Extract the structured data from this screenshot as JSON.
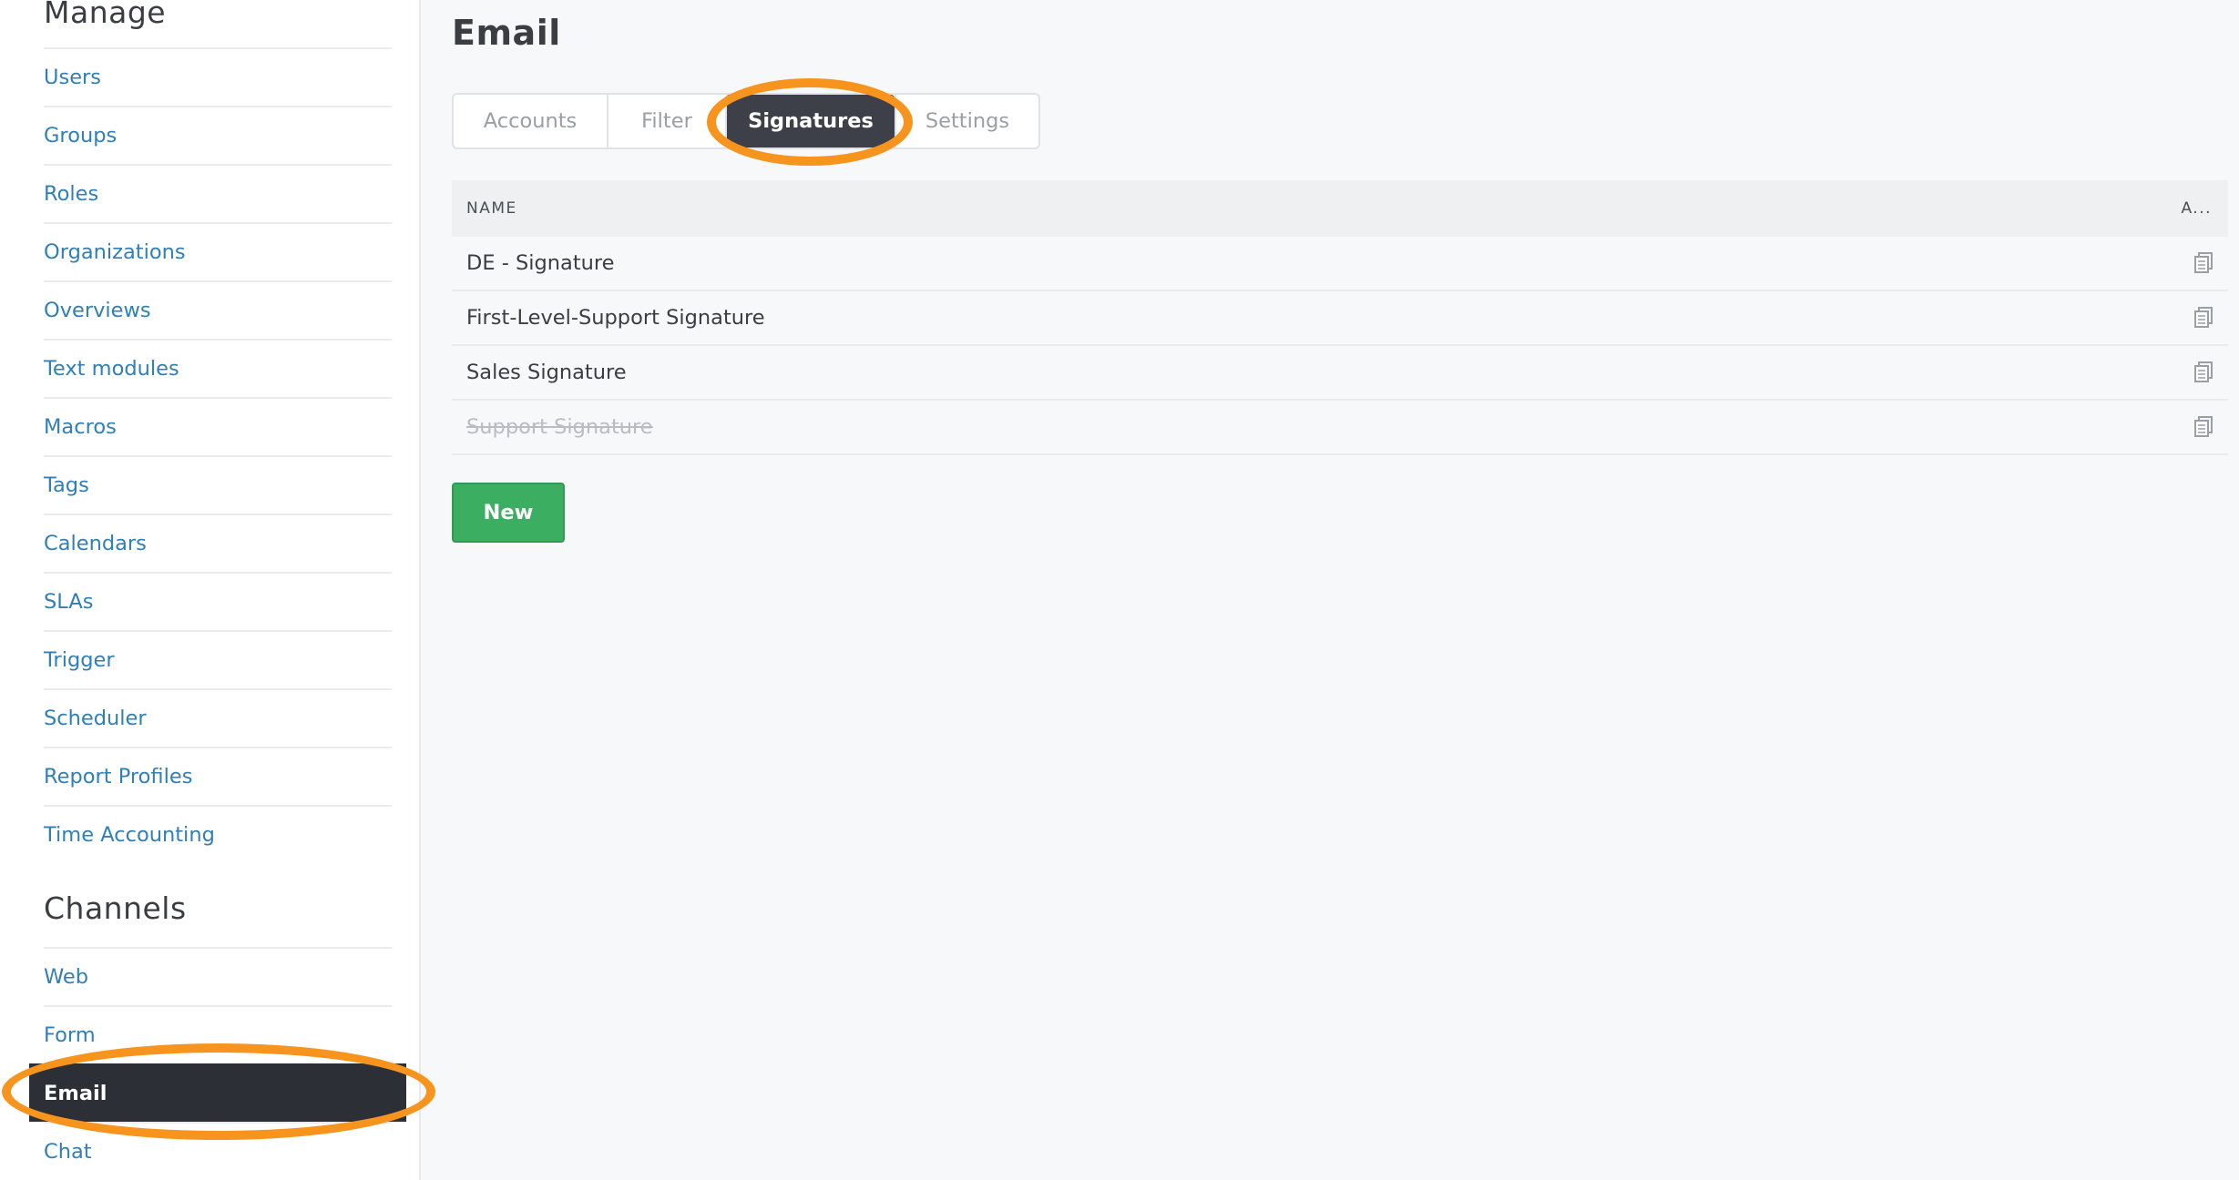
{
  "sidebar": {
    "manage_heading": "Manage",
    "manage_items": [
      {
        "label": "Users"
      },
      {
        "label": "Groups"
      },
      {
        "label": "Roles"
      },
      {
        "label": "Organizations"
      },
      {
        "label": "Overviews"
      },
      {
        "label": "Text modules"
      },
      {
        "label": "Macros"
      },
      {
        "label": "Tags"
      },
      {
        "label": "Calendars"
      },
      {
        "label": "SLAs"
      },
      {
        "label": "Trigger"
      },
      {
        "label": "Scheduler"
      },
      {
        "label": "Report Profiles"
      },
      {
        "label": "Time Accounting"
      }
    ],
    "channels_heading": "Channels",
    "channel_items": [
      {
        "label": "Web"
      },
      {
        "label": "Form"
      },
      {
        "label": "Email",
        "active": true
      },
      {
        "label": "Chat"
      }
    ]
  },
  "main": {
    "title": "Email",
    "tabs": [
      {
        "label": "Accounts"
      },
      {
        "label": "Filter"
      },
      {
        "label": "Signatures",
        "active": true
      },
      {
        "label": "Settings"
      }
    ],
    "table": {
      "columns": [
        "NAME",
        "A..."
      ],
      "rows": [
        {
          "name": "DE - Signature",
          "active": true,
          "action_icon": "clone-icon"
        },
        {
          "name": "First-Level-Support Signature",
          "active": true,
          "action_icon": "clone-icon"
        },
        {
          "name": "Sales Signature",
          "active": true,
          "action_icon": "clone-icon"
        },
        {
          "name": "Support Signature",
          "active": false,
          "action_icon": "clone-icon"
        }
      ]
    },
    "new_button_label": "New"
  },
  "colors": {
    "link": "#2f7fb8",
    "active_nav_bg": "#2d2f37",
    "active_tab_bg": "#3d4048",
    "new_button": "#3cae61",
    "highlight": "#f7941d"
  }
}
